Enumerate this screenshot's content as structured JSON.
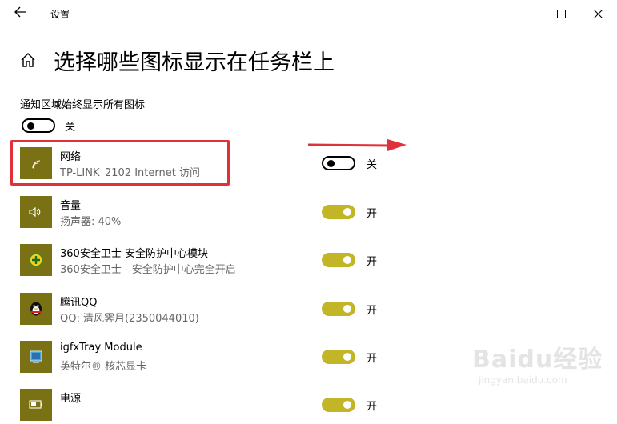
{
  "window": {
    "title": "设置",
    "back_icon": "back-arrow-icon",
    "controls": [
      "minimize-icon",
      "maximize-icon",
      "close-icon"
    ]
  },
  "page": {
    "home_icon": "home-icon",
    "title": "选择哪些图标显示在任务栏上"
  },
  "always_show": {
    "label": "通知区域始终显示所有图标",
    "state": "关",
    "on": false
  },
  "items": [
    {
      "name": "网络",
      "sub": "TP-LINK_2102 Internet 访问",
      "state": "关",
      "on": false,
      "icon": "wifi-icon"
    },
    {
      "name": "音量",
      "sub": "扬声器: 40%",
      "state": "开",
      "on": true,
      "icon": "speaker-icon"
    },
    {
      "name": "360安全卫士 安全防护中心模块",
      "sub": "360安全卫士 - 安全防护中心完全开启",
      "state": "开",
      "on": true,
      "icon": "360-shield-icon"
    },
    {
      "name": "腾讯QQ",
      "sub": "QQ: 清风霁月(2350044010)",
      "state": "开",
      "on": true,
      "icon": "qq-penguin-icon"
    },
    {
      "name": "igfxTray Module",
      "sub": "英特尔® 核芯显卡",
      "state": "开",
      "on": true,
      "icon": "intel-graphics-icon"
    },
    {
      "name": "电源",
      "sub": "",
      "state": "开",
      "on": true,
      "icon": "battery-icon"
    }
  ],
  "colors": {
    "toggle_on": "#c2b526",
    "icon_tile": "#7a7014",
    "annotation": "#e0303a"
  },
  "watermark": {
    "logo": "Baidu经验",
    "url": "jingyan.baidu.com"
  }
}
